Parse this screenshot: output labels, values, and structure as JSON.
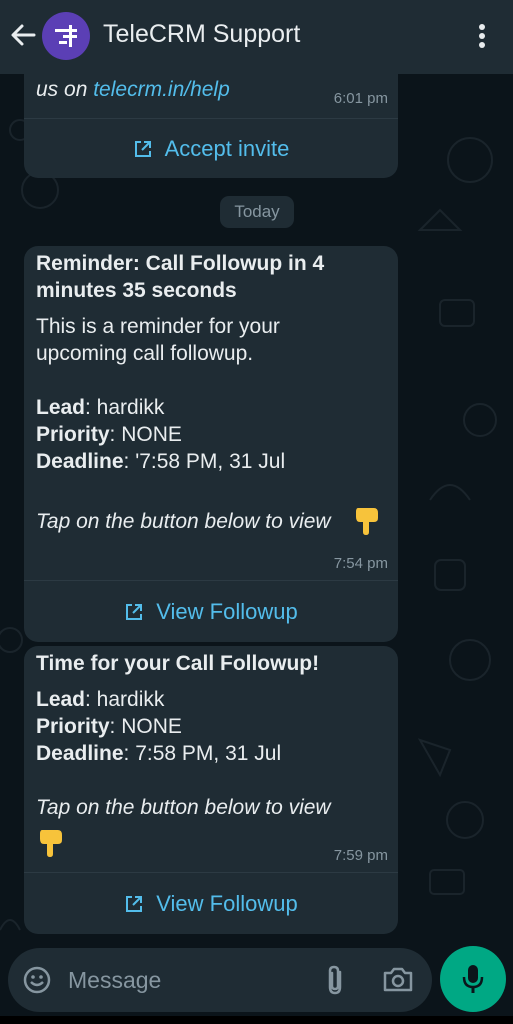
{
  "header": {
    "title": "TeleCRM Support"
  },
  "messages": [
    {
      "lines": [
        "us on",
        "telecrm.in/help"
      ],
      "time": "6:01 pm",
      "button_label": "Accept invite"
    },
    {
      "title_line1": "Reminder: Call Followup in 4",
      "title_line2": "minutes 35 seconds",
      "body_line1": "This is a reminder for your",
      "body_line2": "upcoming call followup.",
      "lead_label": "Lead",
      "lead_value": ": hardikk",
      "priority_label": "Priority",
      "priority_value": ": NONE",
      "deadline_label": "Deadline",
      "deadline_value": ": '7:58 PM, 31 Jul",
      "tap_text": "Tap on the button below to view",
      "time": "7:54 pm",
      "button_label": "View Followup"
    },
    {
      "title": "Time for your Call Followup!",
      "lead_label": "Lead",
      "lead_value": ": hardikk",
      "priority_label": "Priority",
      "priority_value": ": NONE",
      "deadline_label": "Deadline",
      "deadline_value": ": 7:58 PM, 31 Jul",
      "tap_text": "Tap on the button below to view",
      "time": "7:59 pm",
      "button_label": "View Followup"
    }
  ],
  "date_divider": "Today",
  "composer": {
    "placeholder": "Message"
  },
  "icons": {
    "back": "back-arrow-icon",
    "menu": "more-vertical-icon",
    "external": "external-link-icon",
    "emoji": "emoji-icon",
    "attach": "paperclip-icon",
    "camera": "camera-icon",
    "mic": "microphone-icon",
    "point_down": "pointing-down-hand-icon"
  },
  "colors": {
    "accent": "#53bdeb",
    "mic_green": "#00a884",
    "bubble": "#1f2c34",
    "background": "#0b141a"
  }
}
